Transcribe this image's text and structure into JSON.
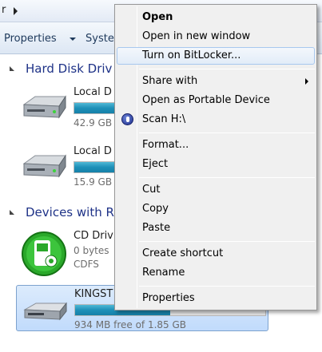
{
  "address": {
    "text": "r"
  },
  "toolbar": {
    "properties": "Properties",
    "system": "Syste"
  },
  "groups": {
    "hard_disk": "Hard Disk Driv",
    "removable": "Devices with R"
  },
  "drives": [
    {
      "name": "Local D",
      "size": "42.9 GB",
      "used_fraction": 0.82
    },
    {
      "name": "Local D",
      "size": "15.9 GB",
      "used_fraction": 0.55
    },
    {
      "name": "CD Driv",
      "size": "0 bytes",
      "filesystem": "CDFS"
    },
    {
      "name": "KINGST",
      "size": "934 MB free of 1.85 GB",
      "used_fraction": 0.5
    }
  ],
  "context_menu": {
    "items": [
      {
        "label": "Open",
        "bold": true
      },
      {
        "label": "Open in new window"
      },
      {
        "label": "Turn on BitLocker...",
        "highlighted": true
      },
      {
        "label": "Share with",
        "submenu": true
      },
      {
        "label": "Open as Portable Device"
      },
      {
        "label": "Scan H:\\",
        "icon": "antivirus-scan-icon"
      },
      {
        "label": "Format..."
      },
      {
        "label": "Eject"
      },
      {
        "label": "Cut"
      },
      {
        "label": "Copy"
      },
      {
        "label": "Paste"
      },
      {
        "label": "Create shortcut"
      },
      {
        "label": "Rename"
      },
      {
        "label": "Properties"
      }
    ]
  },
  "colors": {
    "accent": "#1e3287",
    "bar_fill": "#1e90b8",
    "selection": "#c1dbfc"
  }
}
